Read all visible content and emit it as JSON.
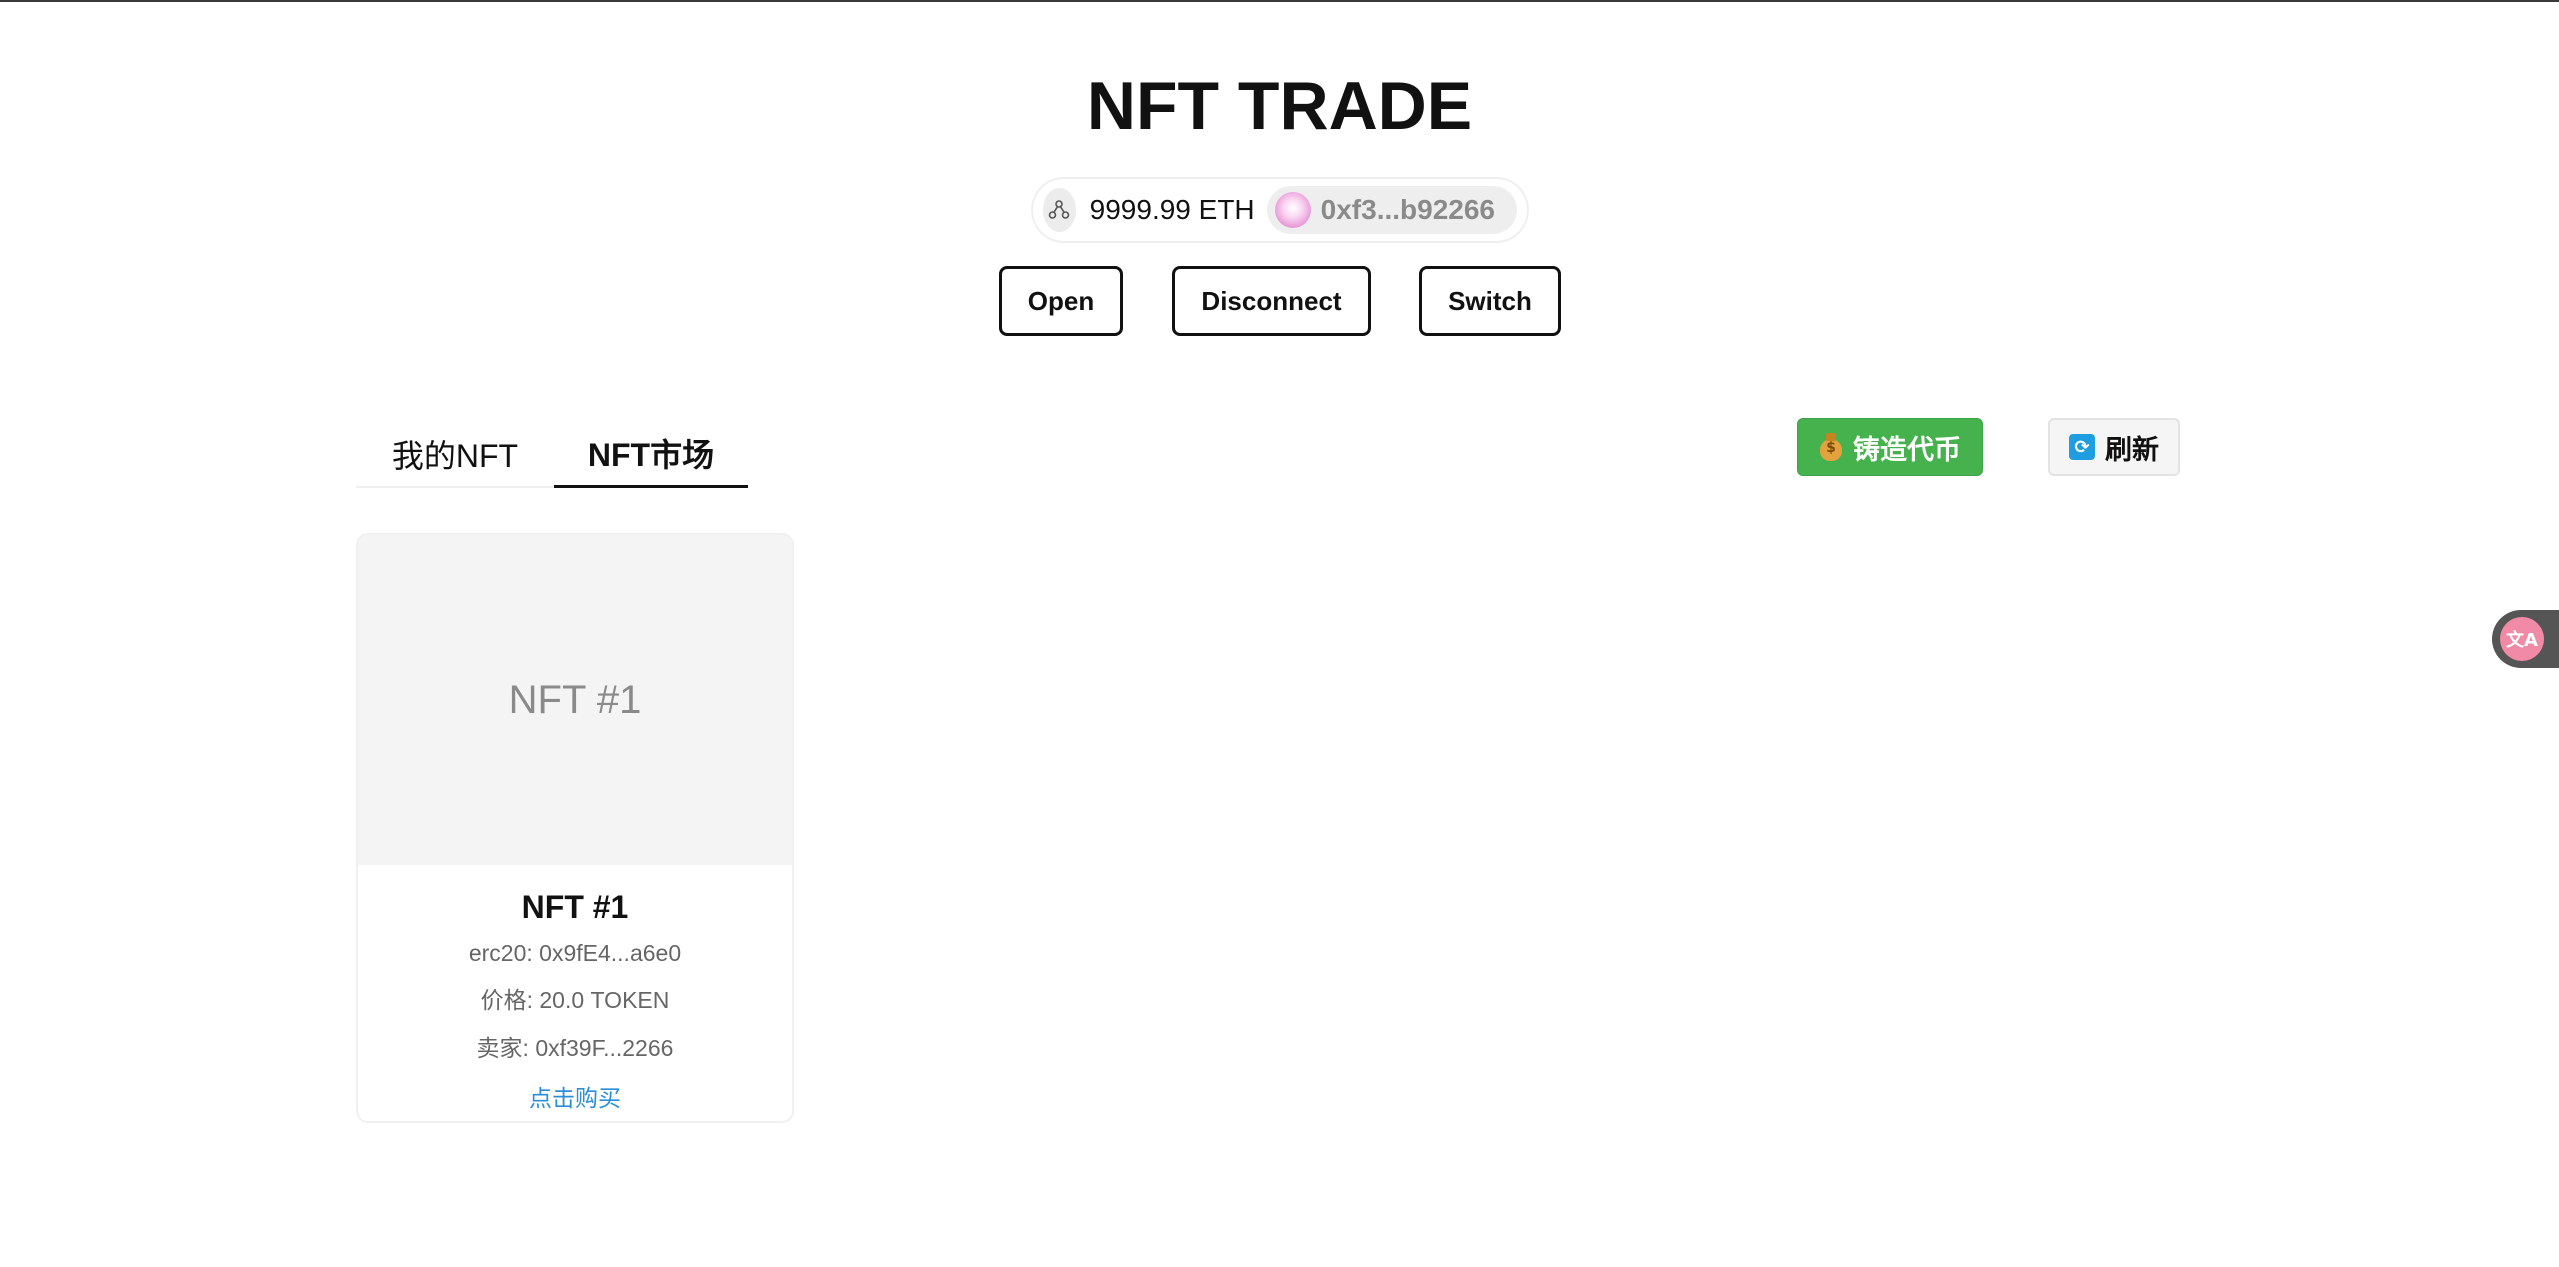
{
  "app": {
    "title": "NFT TRADE"
  },
  "wallet": {
    "network_icon": "network-nodes-icon",
    "balance": "9999.99 ETH",
    "address": "0xf3...b92266"
  },
  "wallet_buttons": {
    "open": "Open",
    "disconnect": "Disconnect",
    "switch": "Switch"
  },
  "tabs": [
    {
      "label": "我的NFT",
      "active": false
    },
    {
      "label": "NFT市场",
      "active": true
    }
  ],
  "actions": {
    "mint_label": "铸造代币",
    "mint_icon": "money-bag-icon",
    "mint_color": "#45b24d",
    "refresh_label": "刷新",
    "refresh_icon": "refresh-icon"
  },
  "nfts": [
    {
      "image_text": "NFT #1",
      "name": "NFT #1",
      "erc20": "erc20: 0x9fE4...a6e0",
      "price": "价格: 20.0 TOKEN",
      "seller": "卖家: 0xf39F...2266",
      "buy_label": "点击购买"
    }
  ],
  "translate_widget": {
    "icon": "translate-icon"
  }
}
